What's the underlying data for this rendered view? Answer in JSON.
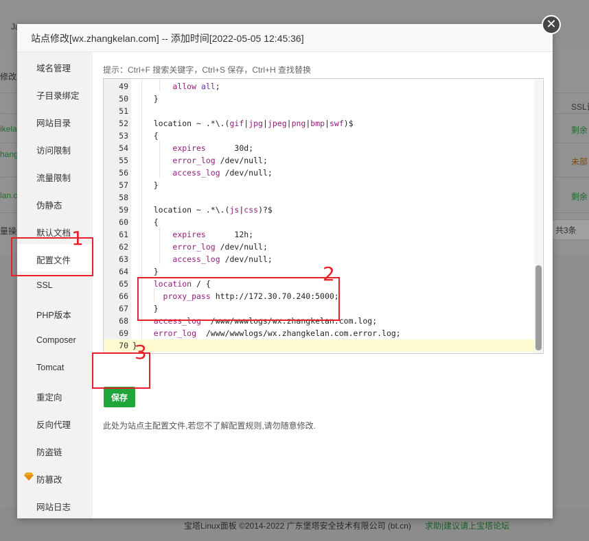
{
  "background": {
    "top_fragment": "Ja",
    "left_fragments": [
      "修改默",
      "ikelan",
      "hang",
      "lan.co",
      "量操作"
    ],
    "right_header": "SSL证",
    "right_status": [
      "剩余",
      "未部",
      "剩余"
    ],
    "total_count": "共3条"
  },
  "modal": {
    "title": "站点修改[wx.zhangkelan.com] -- 添加时间[2022-05-05 12:45:36]",
    "close_symbol": "✕"
  },
  "sidebar": {
    "items": [
      {
        "label": "域名管理"
      },
      {
        "label": "子目录绑定"
      },
      {
        "label": "网站目录"
      },
      {
        "label": "访问限制"
      },
      {
        "label": "流量限制"
      },
      {
        "label": "伪静态"
      },
      {
        "label": "默认文档"
      },
      {
        "label": "配置文件"
      },
      {
        "label": "SSL"
      },
      {
        "label": "PHP版本"
      },
      {
        "label": "Composer"
      },
      {
        "label": "Tomcat"
      },
      {
        "label": "重定向"
      },
      {
        "label": "反向代理"
      },
      {
        "label": "防盗链"
      },
      {
        "label": "防篡改",
        "icon": "diamond-icon"
      },
      {
        "label": "网站日志"
      }
    ],
    "active": "配置文件"
  },
  "editor": {
    "hint": "提示：Ctrl+F 搜索关键字，Ctrl+S 保存，Ctrl+H 查找替换",
    "lines": [
      {
        "n": "49",
        "code": "        allow all;"
      },
      {
        "n": "50",
        "code": "    }"
      },
      {
        "n": "51",
        "code": ""
      },
      {
        "n": "52",
        "code": "    location ~ .*\\.(gif|jpg|jpeg|png|bmp|swf)$"
      },
      {
        "n": "53",
        "code": "    {"
      },
      {
        "n": "54",
        "code": "        expires      30d;"
      },
      {
        "n": "55",
        "code": "        error_log /dev/null;"
      },
      {
        "n": "56",
        "code": "        access_log /dev/null;"
      },
      {
        "n": "57",
        "code": "    }"
      },
      {
        "n": "58",
        "code": ""
      },
      {
        "n": "59",
        "code": "    location ~ .*\\.(js|css)?$"
      },
      {
        "n": "60",
        "code": "    {"
      },
      {
        "n": "61",
        "code": "        expires      12h;"
      },
      {
        "n": "62",
        "code": "        error_log /dev/null;"
      },
      {
        "n": "63",
        "code": "        access_log /dev/null;"
      },
      {
        "n": "64",
        "code": "    }"
      },
      {
        "n": "65",
        "code": "    location / {"
      },
      {
        "n": "66",
        "code": "      proxy_pass http://172.30.70.240:5000;"
      },
      {
        "n": "67",
        "code": "    }"
      },
      {
        "n": "68",
        "code": "    access_log  /www/wwwlogs/wx.zhangkelan.com.log;"
      },
      {
        "n": "69",
        "code": "    error_log  /www/wwwlogs/wx.zhangkelan.com.error.log;"
      },
      {
        "n": "70",
        "code": "}"
      }
    ]
  },
  "save_label": "保存",
  "note": "此处为站点主配置文件,若您不了解配置规则,请勿随意修改.",
  "footer": {
    "copyright": "宝塔Linux面板 ©2014-2022 广东堡塔安全技术有限公司 (bt.cn)",
    "link": "求助|建议请上宝塔论坛"
  },
  "annotations": [
    "1",
    "2",
    "3"
  ],
  "colors": {
    "accent_green": "#20a53a",
    "annotation_red": "#e8202a",
    "keyword": "#931c7e"
  }
}
